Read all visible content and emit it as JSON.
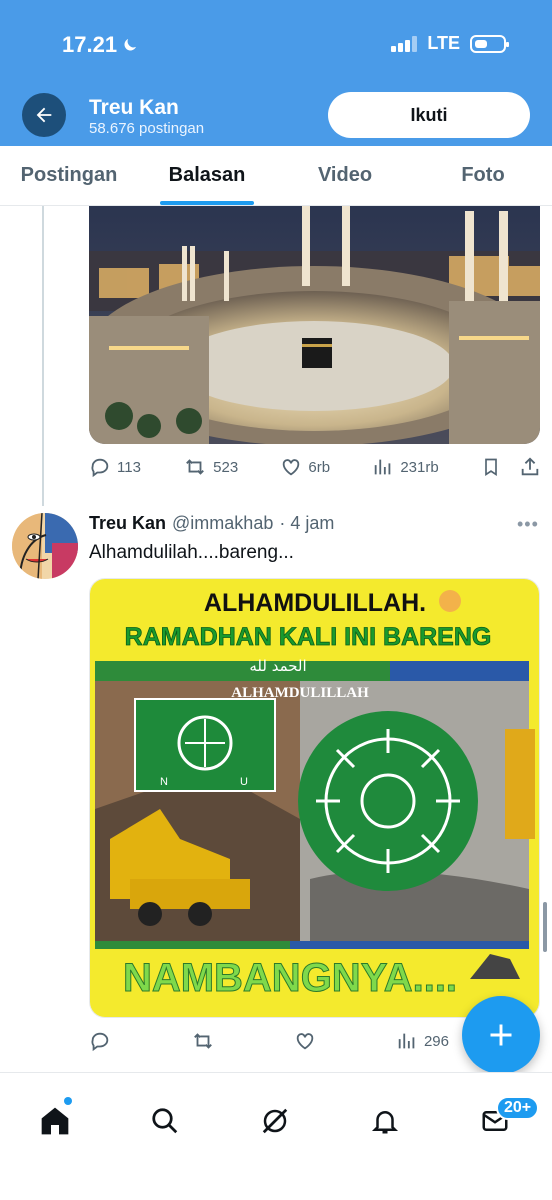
{
  "status_bar": {
    "time": "17.21",
    "network": "LTE"
  },
  "header": {
    "name": "Treu Kan",
    "post_count": "58.676 postingan",
    "follow_label": "Ikuti"
  },
  "tabs": [
    {
      "label": "Postingan",
      "active": false
    },
    {
      "label": "Balasan",
      "active": true
    },
    {
      "label": "Video",
      "active": false
    },
    {
      "label": "Foto",
      "active": false
    }
  ],
  "tweet1": {
    "replies": "113",
    "reposts": "523",
    "likes": "6rb",
    "views": "231rb"
  },
  "tweet2": {
    "name": "Treu Kan",
    "handle": "@immakhab",
    "time": "· 4 jam",
    "text": "Alhamdulilah....bareng...",
    "image_text": {
      "line1": "ALHAMDULILLAH.",
      "line2": "RAMADHAN KALI INI BARENG",
      "arabic": "الحمد لله",
      "banner": "ALHAMDULILLAH",
      "bottom": "NAMBANGNYA...."
    },
    "replies": "",
    "reposts": "",
    "likes": "",
    "views": "296"
  },
  "bottom_nav": {
    "badge": "20+"
  },
  "colors": {
    "header_bg": "#4a9be8",
    "accent": "#1d9bf0"
  }
}
